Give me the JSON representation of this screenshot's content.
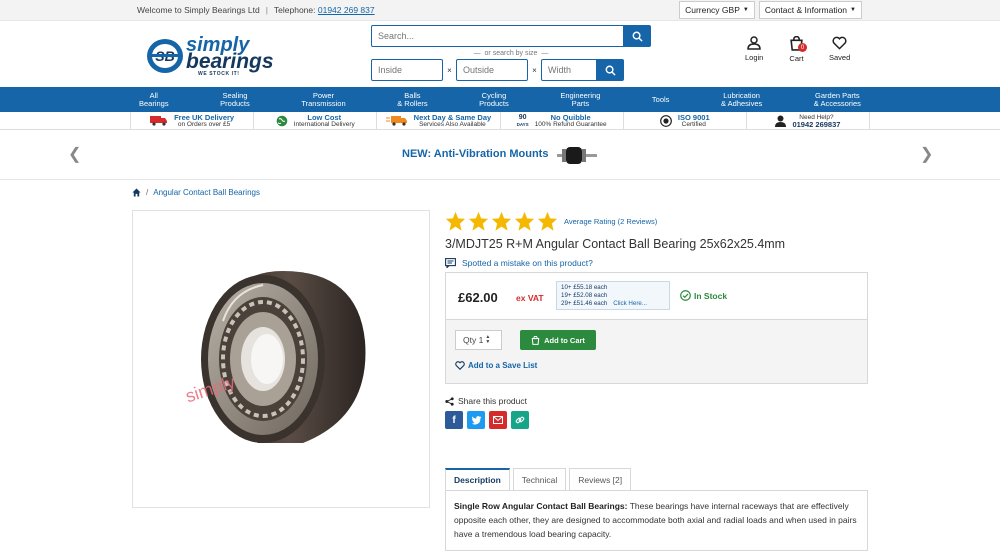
{
  "topbar": {
    "welcome": "Welcome to Simply Bearings Ltd",
    "telephone_label": "Telephone:",
    "telephone_number": "01942 269 837",
    "currency": "Currency GBP",
    "contact": "Contact & Information"
  },
  "logo": {
    "line1": "simply",
    "line2": "bearings",
    "tagline": "WE STOCK IT!"
  },
  "search": {
    "placeholder": "Search...",
    "or_text": "or search by size",
    "inside_placeholder": "Inside",
    "outside_placeholder": "Outside",
    "width_placeholder": "Width",
    "times": "×"
  },
  "account": {
    "login": "Login",
    "cart": "Cart",
    "cart_count": "0",
    "saved": "Saved"
  },
  "nav": [
    {
      "l1": "All",
      "l2": "Bearings"
    },
    {
      "l1": "Sealing",
      "l2": "Products"
    },
    {
      "l1": "Power",
      "l2": "Transmission"
    },
    {
      "l1": "Balls",
      "l2": "& Rollers"
    },
    {
      "l1": "Cycling",
      "l2": "Products"
    },
    {
      "l1": "Engineering",
      "l2": "Parts"
    },
    {
      "l1": "Tools",
      "l2": ""
    },
    {
      "l1": "Lubrication",
      "l2": "& Adhesives"
    },
    {
      "l1": "Garden Parts",
      "l2": "& Accessories"
    }
  ],
  "usp": [
    {
      "t1": "Free UK Delivery",
      "t2": "on Orders over £5",
      "icon": "truck-icon"
    },
    {
      "t1": "Low Cost",
      "t2": "International Delivery",
      "icon": "globe-icon"
    },
    {
      "t1": "Next Day & Same Day",
      "t2": "Services Also Available",
      "icon": "fast-truck-icon"
    },
    {
      "t1": "No Quibble",
      "t2": "100% Refund Guarantee",
      "icon": "90-days-icon",
      "days_num": "90",
      "days_label": "DAYS"
    },
    {
      "t1": "ISO 9001",
      "t2": "Certified",
      "icon": "iso-icon"
    },
    {
      "t1": "01942 269837",
      "t2": "Need Help?",
      "icon": "support-person-icon"
    }
  ],
  "promo": {
    "text": "NEW: Anti-Vibration Mounts"
  },
  "breadcrumb": {
    "category": "Angular Contact Ball Bearings",
    "sep": "/"
  },
  "product": {
    "rating_text": "Average Rating (2 Reviews)",
    "stars": 5,
    "title": "3/MDJT25 R+M Angular Contact Ball Bearing 25x62x25.4mm",
    "mistake": "Spotted a mistake on this product?",
    "price": "£62.00",
    "vat": "ex VAT",
    "tiers": [
      "10+ £55.18 each",
      "19+ £52.08 each",
      "29+ £51.46 each"
    ],
    "tier_more": "Click Here...",
    "stock": "In Stock",
    "qty_label": "Qty",
    "qty_value": "1",
    "add_to_cart": "Add to Cart",
    "save_list": "Add to a Save List",
    "share": "Share this product",
    "watermark": "simply"
  },
  "tabs": [
    "Description",
    "Technical",
    "Reviews [2]"
  ],
  "description": {
    "heading": "Single Row Angular Contact Ball Bearings:",
    "body": "These bearings have internal raceways that are effectively opposite each other, they are designed to accommodate both axial and radial loads and when used in pairs have a tremendous load bearing capacity."
  },
  "colors": {
    "brand_blue": "#1565a8",
    "navy": "#15385e",
    "green": "#2b8a3e",
    "red": "#d62b2b",
    "star": "#f5b800"
  }
}
